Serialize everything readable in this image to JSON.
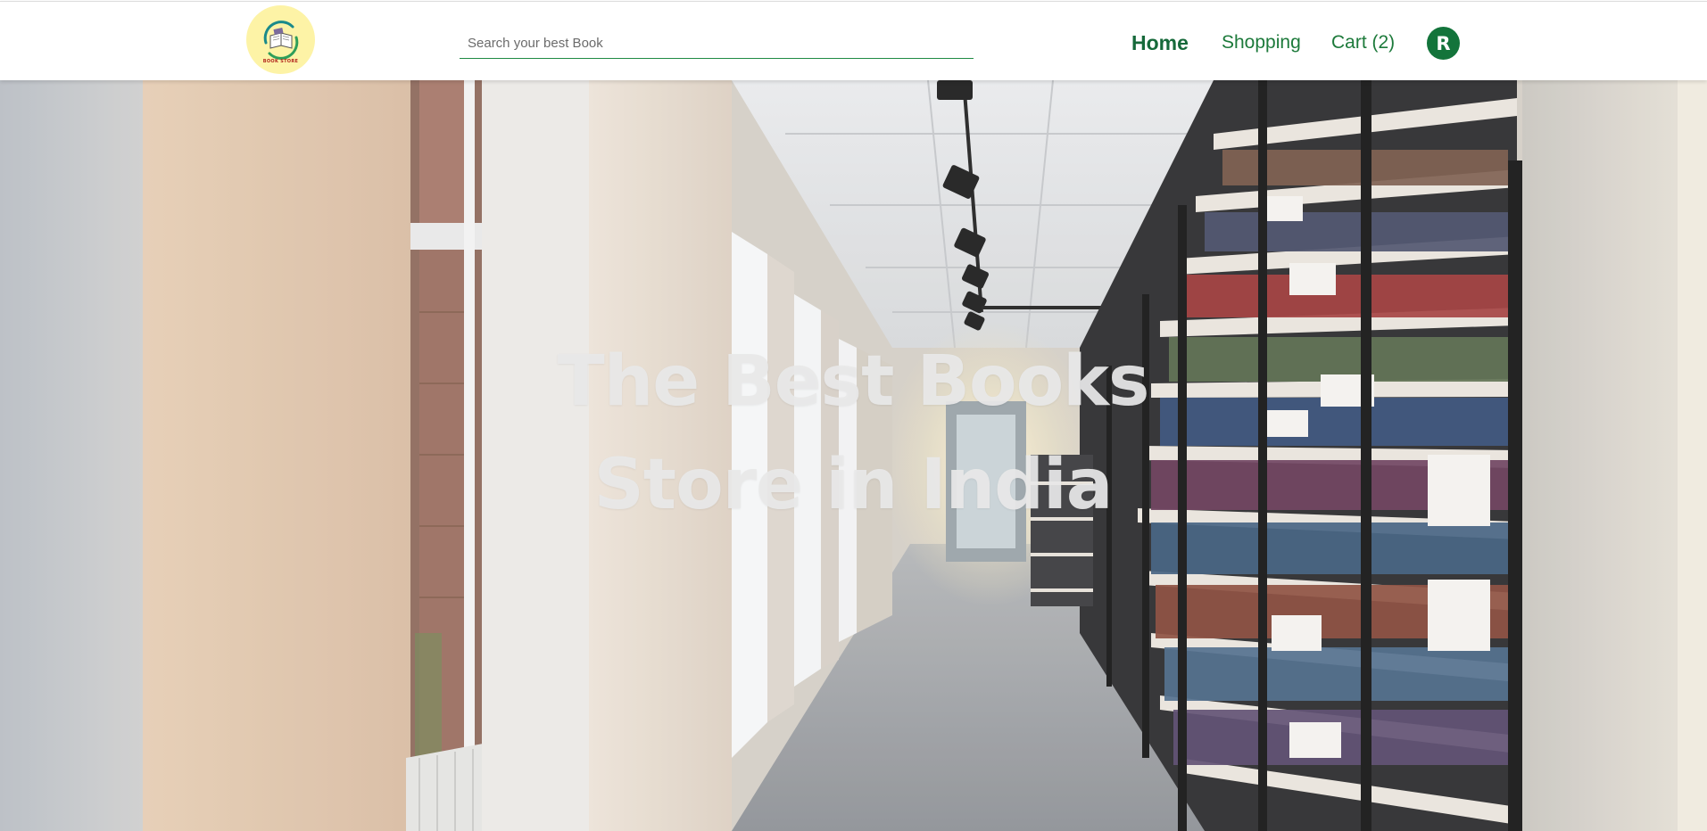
{
  "header": {
    "logo": {
      "icon": "book-logo-icon",
      "text": "BOOK STORE"
    },
    "search": {
      "placeholder": "Search your best Book",
      "value": ""
    },
    "nav": {
      "home_label": "Home",
      "shopping_label": "Shopping",
      "cart_label": "Cart (2)"
    },
    "avatar_initial": "R"
  },
  "hero": {
    "title_line1": "The Best Books",
    "title_line2": "Store in India"
  },
  "colors": {
    "brand_green": "#1d7a3b",
    "avatar_bg": "#13743b",
    "logo_bg": "#fdf3a6"
  }
}
